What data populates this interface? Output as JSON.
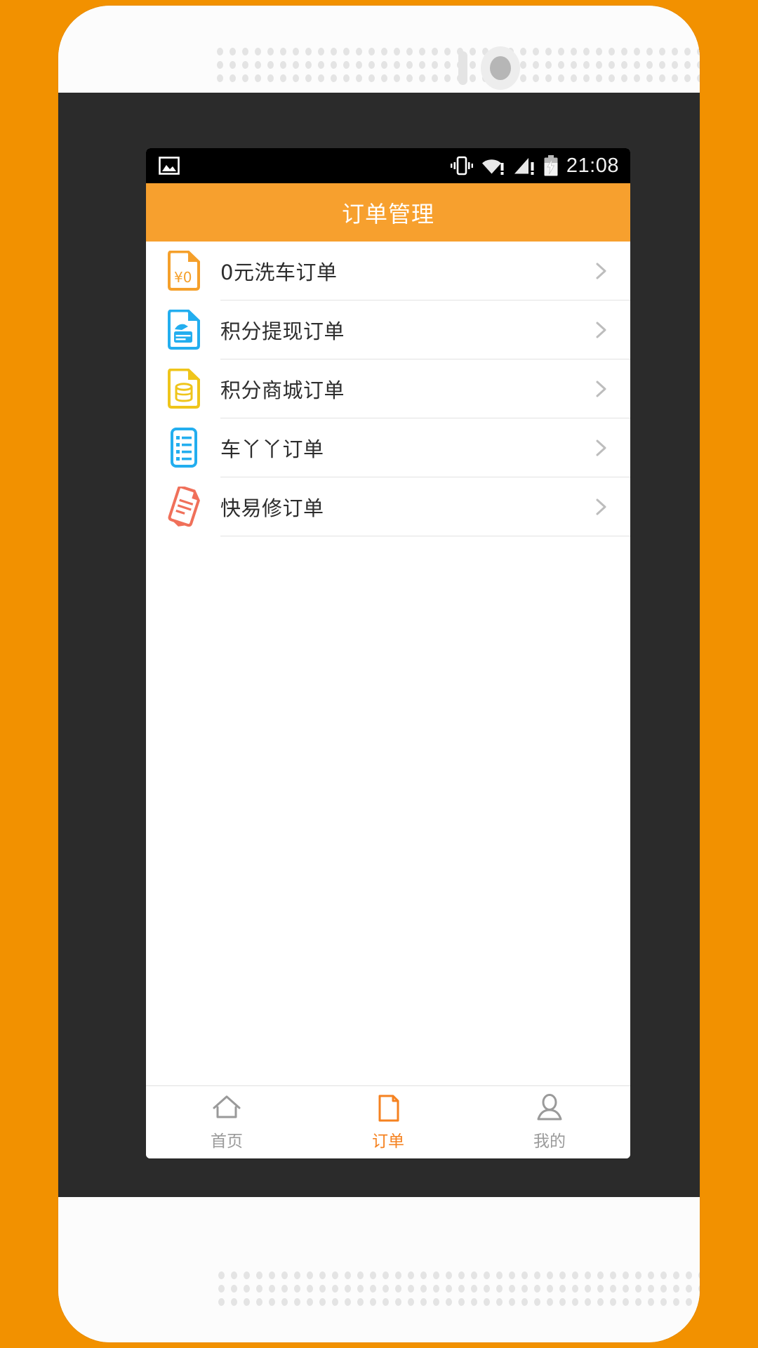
{
  "device": {
    "frame_color": "#2B2B2B",
    "body_color": "#FBFBFB",
    "wallpaper_color": "#F29100"
  },
  "statusbar": {
    "background": "#000000",
    "left_icons": [
      "image-icon"
    ],
    "right_icons": [
      "vibrate-icon",
      "wifi-alert-icon",
      "signal-alert-icon",
      "battery-charging-icon"
    ],
    "time": "21:08"
  },
  "titlebar": {
    "title": "订单管理",
    "background": "#F7A02E",
    "text_color": "#FFFFFF"
  },
  "list": {
    "items": [
      {
        "label": "0元洗车订单",
        "icon": "document-yen-zero-icon",
        "icon_color": "#F5A02B",
        "chevron": "chevron-right-icon"
      },
      {
        "label": "积分提现订单",
        "icon": "document-withdraw-icon",
        "icon_color": "#23AEEF",
        "chevron": "chevron-right-icon"
      },
      {
        "label": "积分商城订单",
        "icon": "document-coins-icon",
        "icon_color": "#EFC51B",
        "chevron": "chevron-right-icon"
      },
      {
        "label": "车丫丫订单",
        "icon": "document-list-icon",
        "icon_color": "#23AEEF",
        "chevron": "chevron-right-icon"
      },
      {
        "label": "快易修订单",
        "icon": "document-tilted-icon",
        "icon_color": "#F0705A",
        "chevron": "chevron-right-icon"
      }
    ]
  },
  "tabbar": {
    "active_color": "#F58220",
    "inactive_color": "#9A9A9A",
    "tabs": [
      {
        "label": "首页",
        "icon": "home-icon",
        "active": false
      },
      {
        "label": "订单",
        "icon": "document-icon",
        "active": true
      },
      {
        "label": "我的",
        "icon": "person-icon",
        "active": false
      }
    ]
  }
}
